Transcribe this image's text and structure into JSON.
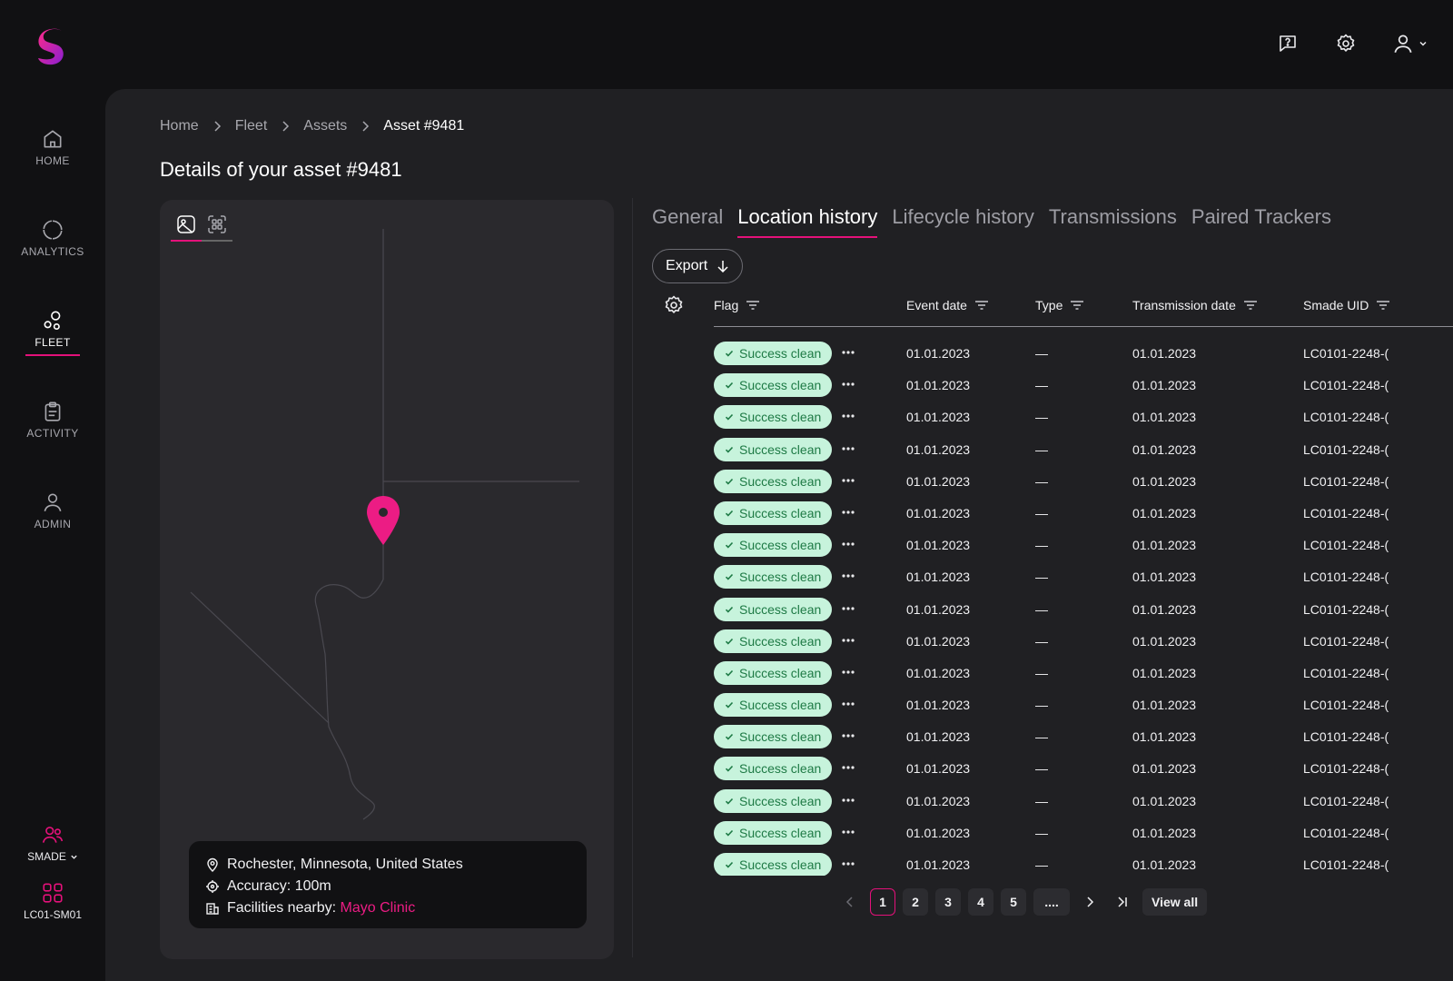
{
  "nav": {
    "items": [
      {
        "label": "HOME",
        "icon": "home-icon"
      },
      {
        "label": "ANALYTICS",
        "icon": "analytics-icon"
      },
      {
        "label": "FLEET",
        "icon": "fleet-icon"
      },
      {
        "label": "ACTIVITY",
        "icon": "activity-icon"
      },
      {
        "label": "ADMIN",
        "icon": "admin-icon"
      }
    ],
    "org": {
      "label": "SMADE",
      "icon": "team-icon"
    },
    "device": {
      "label": "LC01-SM01",
      "icon": "grid-icon"
    }
  },
  "breadcrumb": [
    "Home",
    "Fleet",
    "Assets",
    "Asset #9481"
  ],
  "page_title": "Details of your asset #9481",
  "map": {
    "location": "Rochester, Minnesota, United States",
    "accuracy": "Accuracy: 100m",
    "facilities_label": "Facilities nearby: ",
    "facilities_link": "Mayo Clinic"
  },
  "tabs": [
    "General",
    "Location history",
    "Lifecycle history",
    "Transmissions",
    "Paired Trackers"
  ],
  "export_label": "Export",
  "table": {
    "columns": [
      "Flag",
      "Event date",
      "Type",
      "Transmission date",
      "Smade UID"
    ],
    "rows": [
      {
        "flag": "Success clean",
        "event_date": "01.01.2023",
        "type": "—",
        "transmission_date": "01.01.2023",
        "uid": "LC0101-2248-("
      },
      {
        "flag": "Success clean",
        "event_date": "01.01.2023",
        "type": "—",
        "transmission_date": "01.01.2023",
        "uid": "LC0101-2248-("
      },
      {
        "flag": "Success clean",
        "event_date": "01.01.2023",
        "type": "—",
        "transmission_date": "01.01.2023",
        "uid": "LC0101-2248-("
      },
      {
        "flag": "Success clean",
        "event_date": "01.01.2023",
        "type": "—",
        "transmission_date": "01.01.2023",
        "uid": "LC0101-2248-("
      },
      {
        "flag": "Success clean",
        "event_date": "01.01.2023",
        "type": "—",
        "transmission_date": "01.01.2023",
        "uid": "LC0101-2248-("
      },
      {
        "flag": "Success clean",
        "event_date": "01.01.2023",
        "type": "—",
        "transmission_date": "01.01.2023",
        "uid": "LC0101-2248-("
      },
      {
        "flag": "Success clean",
        "event_date": "01.01.2023",
        "type": "—",
        "transmission_date": "01.01.2023",
        "uid": "LC0101-2248-("
      },
      {
        "flag": "Success clean",
        "event_date": "01.01.2023",
        "type": "—",
        "transmission_date": "01.01.2023",
        "uid": "LC0101-2248-("
      },
      {
        "flag": "Success clean",
        "event_date": "01.01.2023",
        "type": "—",
        "transmission_date": "01.01.2023",
        "uid": "LC0101-2248-("
      },
      {
        "flag": "Success clean",
        "event_date": "01.01.2023",
        "type": "—",
        "transmission_date": "01.01.2023",
        "uid": "LC0101-2248-("
      },
      {
        "flag": "Success clean",
        "event_date": "01.01.2023",
        "type": "—",
        "transmission_date": "01.01.2023",
        "uid": "LC0101-2248-("
      },
      {
        "flag": "Success clean",
        "event_date": "01.01.2023",
        "type": "—",
        "transmission_date": "01.01.2023",
        "uid": "LC0101-2248-("
      },
      {
        "flag": "Success clean",
        "event_date": "01.01.2023",
        "type": "—",
        "transmission_date": "01.01.2023",
        "uid": "LC0101-2248-("
      },
      {
        "flag": "Success clean",
        "event_date": "01.01.2023",
        "type": "—",
        "transmission_date": "01.01.2023",
        "uid": "LC0101-2248-("
      },
      {
        "flag": "Success clean",
        "event_date": "01.01.2023",
        "type": "—",
        "transmission_date": "01.01.2023",
        "uid": "LC0101-2248-("
      },
      {
        "flag": "Success clean",
        "event_date": "01.01.2023",
        "type": "—",
        "transmission_date": "01.01.2023",
        "uid": "LC0101-2248-("
      },
      {
        "flag": "Success clean",
        "event_date": "01.01.2023",
        "type": "—",
        "transmission_date": "01.01.2023",
        "uid": "LC0101-2248-("
      }
    ]
  },
  "pagination": {
    "pages": [
      "1",
      "2",
      "3",
      "4",
      "5",
      "...."
    ],
    "current": "1",
    "view_all": "View all"
  },
  "colors": {
    "accent": "#e4117a",
    "flag_bg": "#c7f3dc",
    "flag_text": "#1e7a45"
  }
}
